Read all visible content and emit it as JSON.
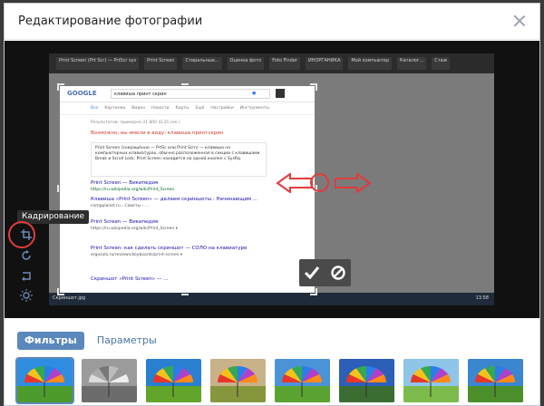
{
  "modal": {
    "title": "Редактирование фотографии"
  },
  "photo": {
    "bookmarks": [
      "Print Screen (Prt Scr) — PrtScr sys",
      "Print Screen",
      "Стиральные...",
      "Оценка фото",
      "Foto Finder",
      "ИНОРГАНИКА",
      "Мой компьютер",
      "Каталог...",
      "Стаж"
    ],
    "google": {
      "logo": "GOOGLE",
      "query": "клавиша принт скрин",
      "tabs": [
        "Все",
        "Картинки",
        "Видео",
        "Новости",
        "Карты",
        "Ещё",
        "Настройки",
        "Инструменты"
      ],
      "results_count": "Результатов: примерно 31 800 (0,35 сек.)",
      "fix_line": "Возможно, вы имели в виду: клавиша принтскрин",
      "card_text": "Print Screen (сокращённо — PrtSc или Print Scrn) — клавиша на компьютерных клавиатурах, обычно расположенная в секции с клавишами Break и Scroll Lock. Print Screen находится на одной кнопке с SysRq.",
      "card_link": "Print Screen — Википедия",
      "card_url": "https://ru.wikipedia.org/wiki/Print_Screen",
      "results": [
        {
          "title": "Клавиша «Print Screen» — делаем скриншоты : Начинающим ...",
          "snip": "compplanet.ru › Советы › ..."
        },
        {
          "title": "Print Screen — Википедия",
          "snip": "https://ru.wikipedia.org/wiki/Print_Screen ▾"
        },
        {
          "title": "Print Screen: как сделать скриншот — СОЛО на клавиатуре",
          "snip": "ergosolo.ru/reviews/keyboards/print-screen ▾"
        },
        {
          "title": "Скриншот «Print Screen» — ...",
          "snip": ""
        }
      ]
    },
    "taskbar_item": "Скриншот.jpg",
    "taskbar_time": "13:58"
  },
  "toolbar": {
    "tooltip": "Кадрирование",
    "tools": [
      "crop-icon",
      "rotate-icon",
      "rotate-alt-icon",
      "brightness-icon"
    ]
  },
  "confirm": {
    "ok_icon": "check-icon",
    "cancel_icon": "cancel-icon"
  },
  "tabs": {
    "filters": "Фильтры",
    "params": "Параметры"
  },
  "colors": {
    "accent": "#5b88bd",
    "annotation": "#e23b3b"
  }
}
